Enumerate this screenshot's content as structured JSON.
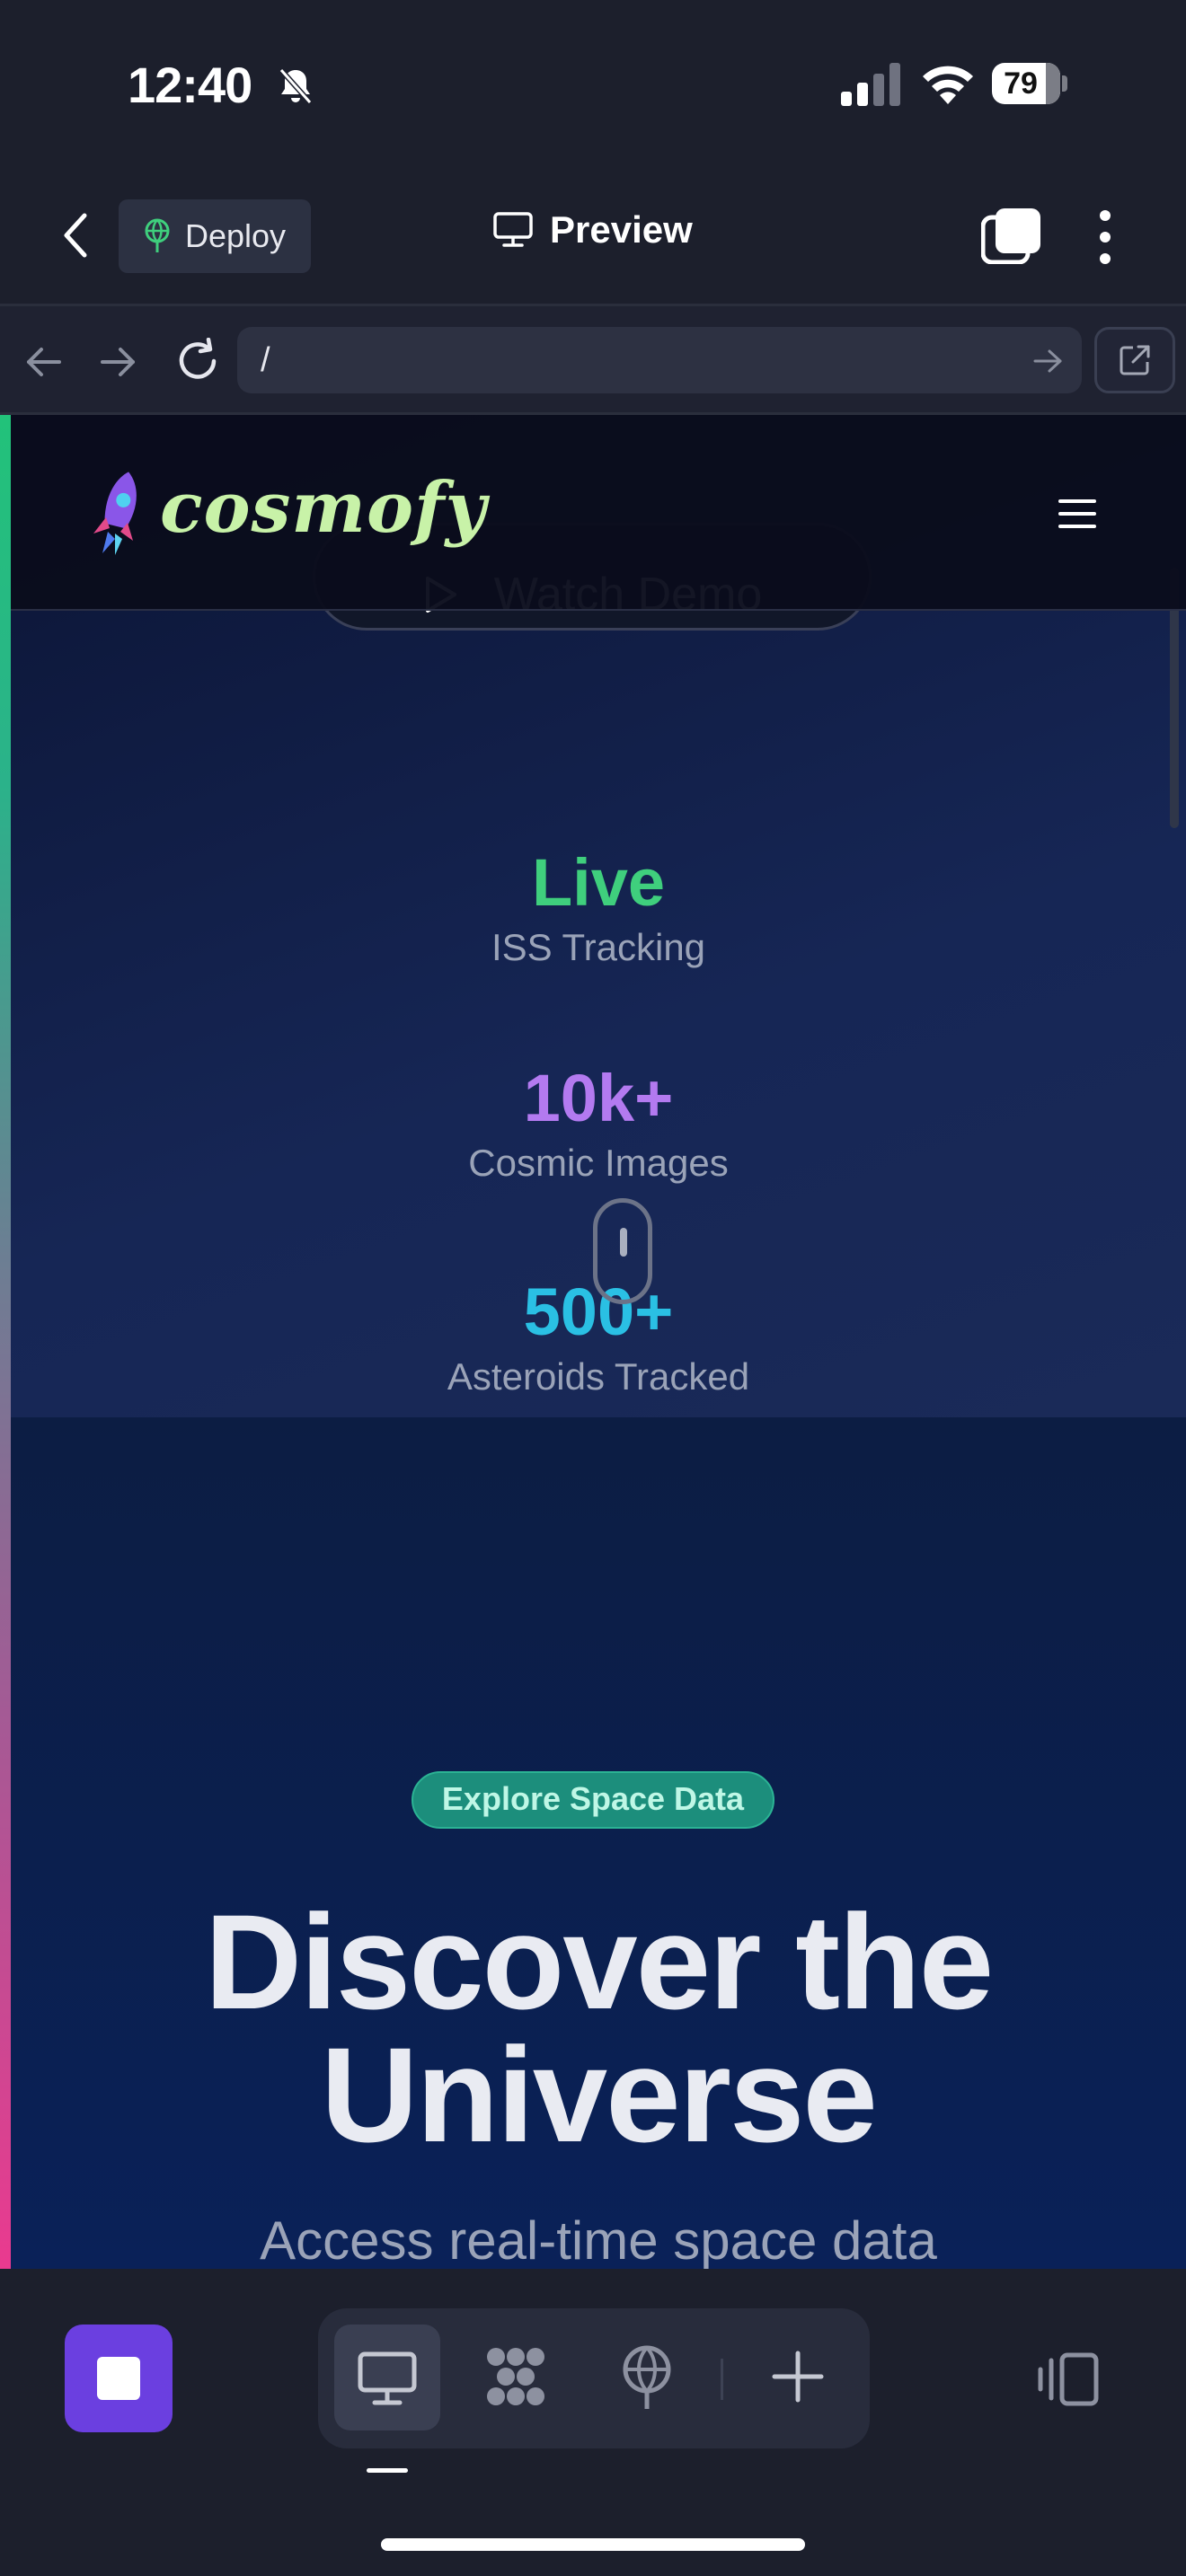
{
  "status_bar": {
    "time": "12:40",
    "battery": "79"
  },
  "header": {
    "deploy_label": "Deploy",
    "preview_label": "Preview"
  },
  "browser": {
    "url": "/"
  },
  "site": {
    "logo_text": "cosmofy",
    "watch_demo_label": "Watch Demo",
    "stats": [
      {
        "value": "Live",
        "label": "ISS Tracking",
        "color": "#3fcf7d"
      },
      {
        "value": "10k+",
        "label": "Cosmic Images",
        "color": "#b37af0"
      },
      {
        "value": "500+",
        "label": "Asteroids Tracked",
        "color": "#2ac0e4"
      }
    ],
    "badge": "Explore Space Data",
    "hero_line1": "Discover the",
    "hero_line2": "Universe",
    "hero_sub": "Access real-time space data"
  },
  "toolbar": {
    "icons": [
      "stop-icon",
      "desktop-icon",
      "components-icon",
      "deploy-icon",
      "plus-icon",
      "panel-icon"
    ]
  }
}
